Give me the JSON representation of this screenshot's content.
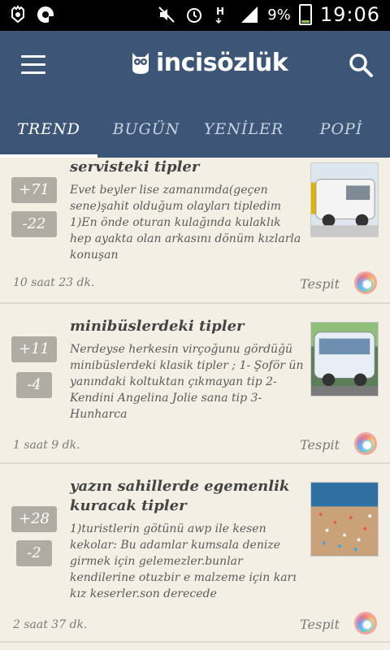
{
  "statusbar": {
    "left_icons": [
      "hand-icon",
      "media-icon"
    ],
    "right_icons": [
      "mute-icon",
      "alarm-icon",
      "h-data-icon",
      "signal-icon"
    ],
    "battery": "9%",
    "time": "19:06",
    "battery_level": 0.09
  },
  "appbar": {
    "menu_icon": "hamburger-icon",
    "logo_icon": "owl-icon",
    "title": "incisözlük",
    "search_icon": "search-icon"
  },
  "tabs": [
    {
      "label": "TREND"
    },
    {
      "label": "BUGÜN"
    },
    {
      "label": "YENİLER"
    },
    {
      "label": "POPİ"
    }
  ],
  "entries": [
    {
      "up": "+71",
      "down": "-22",
      "title": "servisteki tipler",
      "excerpt": "Evet beyler lise zamanımda(geçen sene)şahit olduğum olayları tipledim 1)En önde oturan kulağında kulaklık hep ayakta olan arkasını dönüm kızlarla konuşan",
      "time": "10 saat 23 dk.",
      "author": "Tespit"
    },
    {
      "up": "+11",
      "down": "-4",
      "title": "minibüslerdeki tipler",
      "excerpt": "Nerdeyse herkesin virçoğunu gördüğü minibüslerdeki klasik tipler ; 1- Şoför ün yanındaki koltuktan çıkmayan tip 2- Kendini Angelina Jolie sana tip 3- Hunharca",
      "time": "1 saat 9 dk.",
      "author": "Tespit"
    },
    {
      "up": "+28",
      "down": "-2",
      "title": "yazın sahillerde egemenlik kuracak tipler",
      "excerpt": "1)turistlerin götünü awp ile kesen kekolar: Bu adamlar kumsala denize girmek için gelemezler.bunlar kendilerine otuzbir e malzeme için karı kız keserler.son derecede",
      "time": "2 saat 37 dk.",
      "author": "Tespit"
    }
  ],
  "colors": {
    "appbar": "#3d5677",
    "background": "#f3efe4",
    "vote": "#b0aca3"
  }
}
